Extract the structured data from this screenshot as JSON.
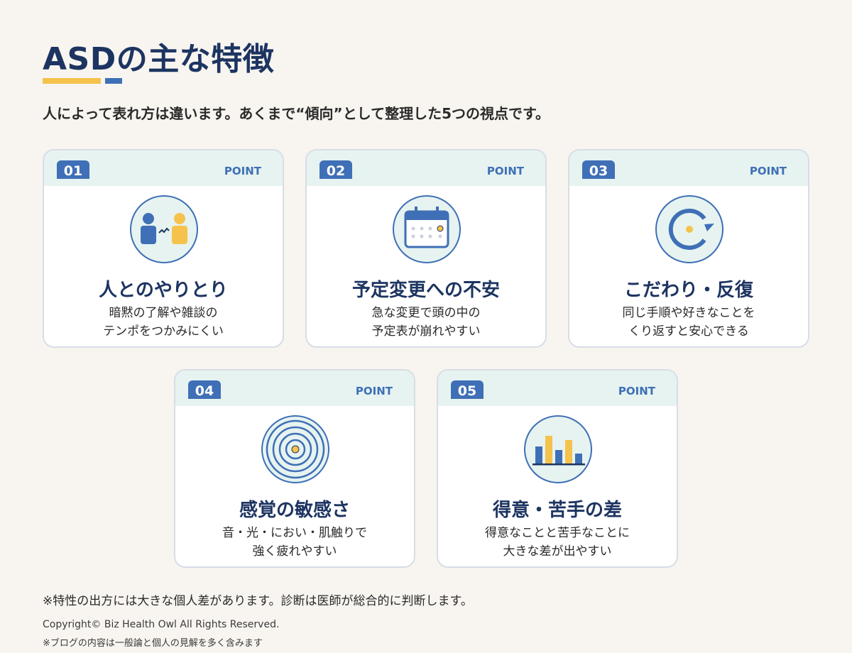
{
  "header": {
    "title": "ASDの主な特徴",
    "subtitle": "人によって表れ方は違います。あくまで“傾向”として整理した5つの視点です。"
  },
  "colors": {
    "navy": "#1d3461",
    "blue": "#3f6fb6",
    "yellow": "#f5c24c",
    "mint": "#e6f3f0",
    "background": "#f8f5f0"
  },
  "cards": [
    {
      "num": "01",
      "tag": "POINT",
      "icon": "people-communication-icon",
      "title": "人とのやりとり",
      "desc1": "暗黙の了解や雑談の",
      "desc2": "テンポをつかみにくい"
    },
    {
      "num": "02",
      "tag": "POINT",
      "icon": "calendar-icon",
      "title": "予定変更への不安",
      "desc1": "急な変更で頭の中の",
      "desc2": "予定表が崩れやすい"
    },
    {
      "num": "03",
      "tag": "POINT",
      "icon": "repeat-cycle-icon",
      "title": "こだわり・反復",
      "desc1": "同じ手順や好きなことを",
      "desc2": "くり返すと安心できる"
    },
    {
      "num": "04",
      "tag": "POINT",
      "icon": "concentric-circles-icon",
      "title": "感覚の敏感さ",
      "desc1": "音・光・におい・肌触りで",
      "desc2": "強く疲れやすい"
    },
    {
      "num": "05",
      "tag": "POINT",
      "icon": "bar-chart-icon",
      "title": "得意・苦手の差",
      "desc1": "得意なことと苦手なことに",
      "desc2": "大きな差が出やすい"
    }
  ],
  "footer": {
    "note": "※特性の出方には大きな個人差があります。診断は医師が総合的に判断します。",
    "copyright": "Copyright© Biz Health Owl All Rights Reserved.",
    "disclaimer": "※ブログの内容は一般論と個人の見解を多く含みます"
  }
}
